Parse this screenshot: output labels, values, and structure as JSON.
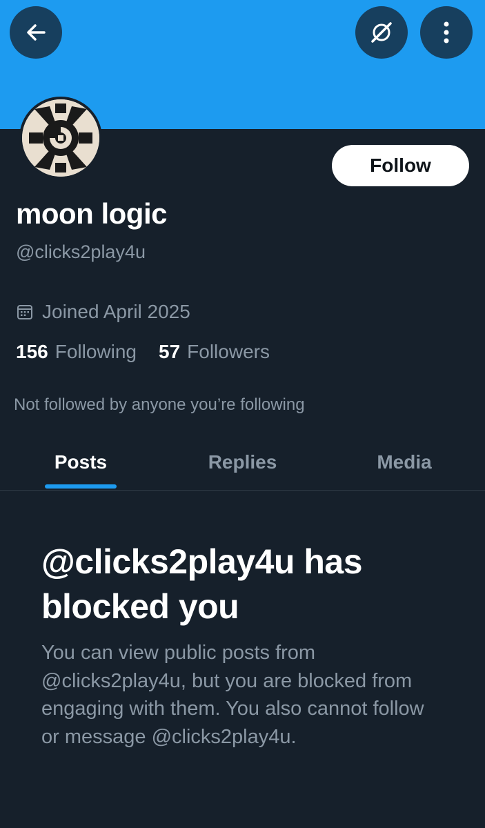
{
  "header": {
    "back_icon": "arrow-left-icon",
    "grok_icon": "grok-icon",
    "more_icon": "more-vertical-icon",
    "banner_color": "#1d9bf0"
  },
  "profile": {
    "display_name": "moon logic",
    "handle": "@clicks2play4u",
    "follow_label": "Follow",
    "joined": "Joined April 2025",
    "following_count": "156",
    "following_label": "Following",
    "followers_count": "57",
    "followers_label": "Followers",
    "not_followed_text": "Not followed by anyone you’re following"
  },
  "tabs": [
    {
      "label": "Posts",
      "active": true
    },
    {
      "label": "Replies",
      "active": false
    },
    {
      "label": "Media",
      "active": false
    }
  ],
  "blocked": {
    "title": "@clicks2play4u has blocked you",
    "description": "You can view public posts from @clicks2play4u, but you are blocked from engaging with them. You also cannot follow or message @clicks2play4u."
  },
  "colors": {
    "accent": "#1d9bf0",
    "background": "#16202b",
    "secondary_text": "#8b98a5"
  }
}
